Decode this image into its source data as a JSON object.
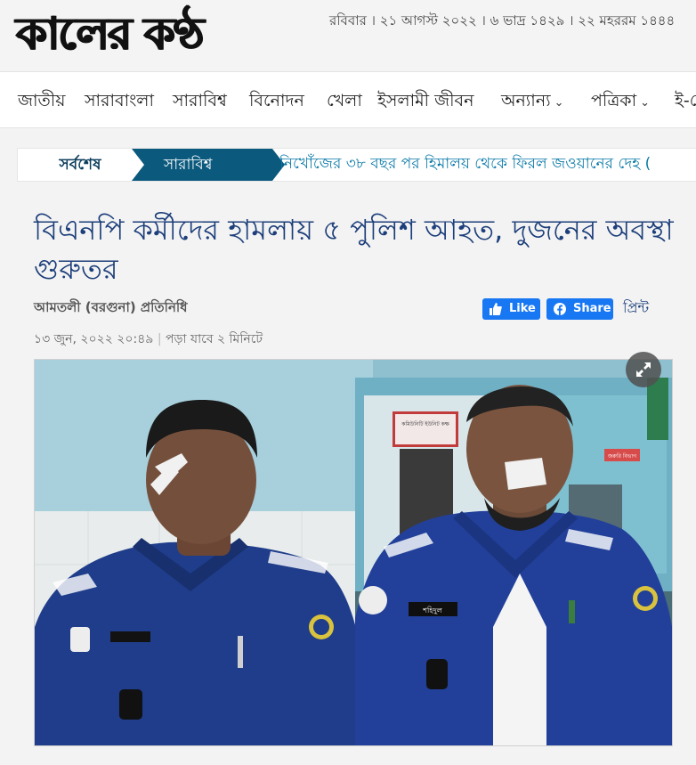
{
  "header": {
    "logo_text": "কালের কণ্ঠ",
    "dateline": "রবিবার । ২১ আগস্ট ২০২২ । ৬ ভাদ্র ১৪২৯ । ২২ মহররম ১৪৪৪"
  },
  "nav": {
    "items": [
      {
        "label": "জাতীয়"
      },
      {
        "label": "সারাবাংলা"
      },
      {
        "label": "সারাবিশ্ব"
      },
      {
        "label": "বিনোদন"
      },
      {
        "label": "খেলা"
      },
      {
        "label": "ইসলামী জীবন"
      },
      {
        "label": "অন্যান্য"
      },
      {
        "label": "পত্রিকা"
      },
      {
        "label": "ই-পে"
      }
    ]
  },
  "ticker": {
    "latest_label": "সর্বশেষ",
    "category_label": "সারাবিশ্ব",
    "headline": "নিখোঁজের ৩৮ বছর পর হিমালয় থেকে ফিরল জওয়ানের দেহ (",
    "colors": {
      "category_bg": "#0b5a7e",
      "link": "#0b7aa8"
    }
  },
  "article": {
    "headline": "বিএনপি কর্মীদের হামলায় ৫ পুলিশ আহত, দুজনের অবস্থা গুরুতর",
    "reporter": "আমতলী (বরগুনা) প্রতিনিধি",
    "published": "১৩ জুন, ২০২২ ২০:৪৯",
    "read_time": "পড়া যাবে ২ মিনিটে",
    "social": {
      "like_label": "Like",
      "share_label": "Share",
      "print_label": "প্রিন্ট",
      "color": "#1877f2"
    },
    "photo": {
      "ward_sign_text": "কমিউনিটি ইউনিট কক্ষ",
      "name_tag": "শহিদুল",
      "arrow_sign": "জরুরি বিভাগ"
    }
  }
}
